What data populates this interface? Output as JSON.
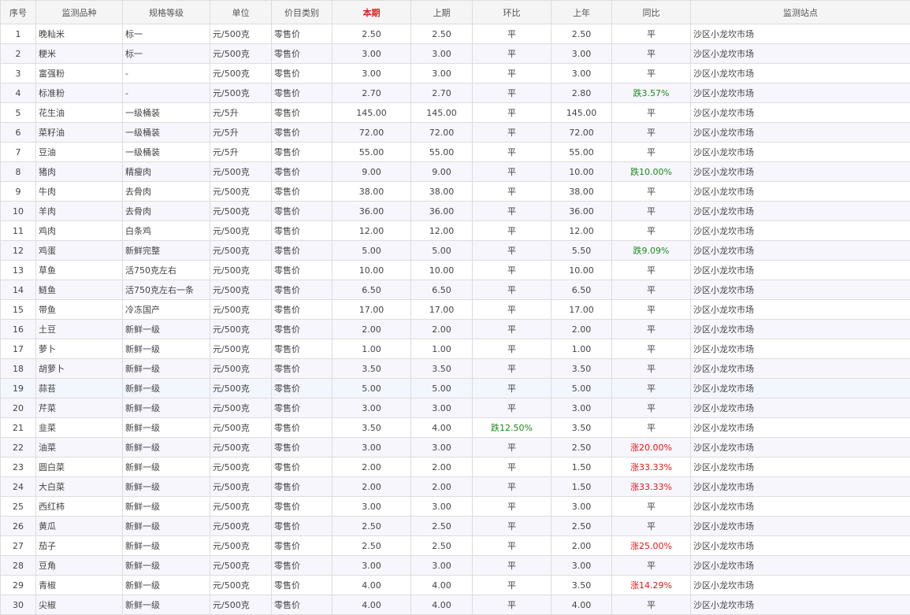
{
  "table": {
    "headers": [
      "序号",
      "监测品种",
      "规格等级",
      "单位",
      "价目类别",
      "本期",
      "上期",
      "环比",
      "上年",
      "同比",
      "监测站点"
    ],
    "rows": [
      {
        "no": "1",
        "item": "晚籼米",
        "grade": "标一",
        "unit": "元/500克",
        "category": "零售价",
        "current": "2.50",
        "previous": "2.50",
        "mom": "平",
        "last_year": "2.50",
        "yoy": "平",
        "site": "沙区小龙坎市场"
      },
      {
        "no": "2",
        "item": "粳米",
        "grade": "标一",
        "unit": "元/500克",
        "category": "零售价",
        "current": "3.00",
        "previous": "3.00",
        "mom": "平",
        "last_year": "3.00",
        "yoy": "平",
        "site": "沙区小龙坎市场"
      },
      {
        "no": "3",
        "item": "富强粉",
        "grade": "-",
        "unit": "元/500克",
        "category": "零售价",
        "current": "3.00",
        "previous": "3.00",
        "mom": "平",
        "last_year": "3.00",
        "yoy": "平",
        "site": "沙区小龙坎市场"
      },
      {
        "no": "4",
        "item": "标准粉",
        "grade": "-",
        "unit": "元/500克",
        "category": "零售价",
        "current": "2.70",
        "previous": "2.70",
        "mom": "平",
        "last_year": "2.80",
        "yoy": "跌3.57%",
        "site": "沙区小龙坎市场"
      },
      {
        "no": "5",
        "item": "花生油",
        "grade": "一级桶装",
        "unit": "元/5升",
        "category": "零售价",
        "current": "145.00",
        "previous": "145.00",
        "mom": "平",
        "last_year": "145.00",
        "yoy": "平",
        "site": "沙区小龙坎市场"
      },
      {
        "no": "6",
        "item": "菜籽油",
        "grade": "一级桶装",
        "unit": "元/5升",
        "category": "零售价",
        "current": "72.00",
        "previous": "72.00",
        "mom": "平",
        "last_year": "72.00",
        "yoy": "平",
        "site": "沙区小龙坎市场"
      },
      {
        "no": "7",
        "item": "豆油",
        "grade": "一级桶装",
        "unit": "元/5升",
        "category": "零售价",
        "current": "55.00",
        "previous": "55.00",
        "mom": "平",
        "last_year": "55.00",
        "yoy": "平",
        "site": "沙区小龙坎市场"
      },
      {
        "no": "8",
        "item": "猪肉",
        "grade": "精瘦肉",
        "unit": "元/500克",
        "category": "零售价",
        "current": "9.00",
        "previous": "9.00",
        "mom": "平",
        "last_year": "10.00",
        "yoy": "跌10.00%",
        "site": "沙区小龙坎市场"
      },
      {
        "no": "9",
        "item": "牛肉",
        "grade": "去骨肉",
        "unit": "元/500克",
        "category": "零售价",
        "current": "38.00",
        "previous": "38.00",
        "mom": "平",
        "last_year": "38.00",
        "yoy": "平",
        "site": "沙区小龙坎市场"
      },
      {
        "no": "10",
        "item": "羊肉",
        "grade": "去骨肉",
        "unit": "元/500克",
        "category": "零售价",
        "current": "36.00",
        "previous": "36.00",
        "mom": "平",
        "last_year": "36.00",
        "yoy": "平",
        "site": "沙区小龙坎市场"
      },
      {
        "no": "11",
        "item": "鸡肉",
        "grade": "白条鸡",
        "unit": "元/500克",
        "category": "零售价",
        "current": "12.00",
        "previous": "12.00",
        "mom": "平",
        "last_year": "12.00",
        "yoy": "平",
        "site": "沙区小龙坎市场"
      },
      {
        "no": "12",
        "item": "鸡蛋",
        "grade": "新鲜完整",
        "unit": "元/500克",
        "category": "零售价",
        "current": "5.00",
        "previous": "5.00",
        "mom": "平",
        "last_year": "5.50",
        "yoy": "跌9.09%",
        "site": "沙区小龙坎市场"
      },
      {
        "no": "13",
        "item": "草鱼",
        "grade": "活750克左右",
        "unit": "元/500克",
        "category": "零售价",
        "current": "10.00",
        "previous": "10.00",
        "mom": "平",
        "last_year": "10.00",
        "yoy": "平",
        "site": "沙区小龙坎市场"
      },
      {
        "no": "14",
        "item": "鲢鱼",
        "grade": "活750克左右一条",
        "unit": "元/500克",
        "category": "零售价",
        "current": "6.50",
        "previous": "6.50",
        "mom": "平",
        "last_year": "6.50",
        "yoy": "平",
        "site": "沙区小龙坎市场"
      },
      {
        "no": "15",
        "item": "带鱼",
        "grade": "冷冻国产",
        "unit": "元/500克",
        "category": "零售价",
        "current": "17.00",
        "previous": "17.00",
        "mom": "平",
        "last_year": "17.00",
        "yoy": "平",
        "site": "沙区小龙坎市场"
      },
      {
        "no": "16",
        "item": "土豆",
        "grade": "新鲜一级",
        "unit": "元/500克",
        "category": "零售价",
        "current": "2.00",
        "previous": "2.00",
        "mom": "平",
        "last_year": "2.00",
        "yoy": "平",
        "site": "沙区小龙坎市场"
      },
      {
        "no": "17",
        "item": "萝卜",
        "grade": "新鲜一级",
        "unit": "元/500克",
        "category": "零售价",
        "current": "1.00",
        "previous": "1.00",
        "mom": "平",
        "last_year": "1.00",
        "yoy": "平",
        "site": "沙区小龙坎市场"
      },
      {
        "no": "18",
        "item": "胡萝卜",
        "grade": "新鲜一级",
        "unit": "元/500克",
        "category": "零售价",
        "current": "3.50",
        "previous": "3.50",
        "mom": "平",
        "last_year": "3.50",
        "yoy": "平",
        "site": "沙区小龙坎市场"
      },
      {
        "no": "19",
        "item": "蒜苔",
        "grade": "新鲜一级",
        "unit": "元/500克",
        "category": "零售价",
        "current": "5.00",
        "previous": "5.00",
        "mom": "平",
        "last_year": "5.00",
        "yoy": "平",
        "site": "沙区小龙坎市场"
      },
      {
        "no": "20",
        "item": "芹菜",
        "grade": "新鲜一级",
        "unit": "元/500克",
        "category": "零售价",
        "current": "3.00",
        "previous": "3.00",
        "mom": "平",
        "last_year": "3.00",
        "yoy": "平",
        "site": "沙区小龙坎市场"
      },
      {
        "no": "21",
        "item": "韭菜",
        "grade": "新鲜一级",
        "unit": "元/500克",
        "category": "零售价",
        "current": "3.50",
        "previous": "4.00",
        "mom": "跌12.50%",
        "last_year": "3.50",
        "yoy": "平",
        "site": "沙区小龙坎市场"
      },
      {
        "no": "22",
        "item": "油菜",
        "grade": "新鲜一级",
        "unit": "元/500克",
        "category": "零售价",
        "current": "3.00",
        "previous": "3.00",
        "mom": "平",
        "last_year": "2.50",
        "yoy": "涨20.00%",
        "site": "沙区小龙坎市场"
      },
      {
        "no": "23",
        "item": "圆白菜",
        "grade": "新鲜一级",
        "unit": "元/500克",
        "category": "零售价",
        "current": "2.00",
        "previous": "2.00",
        "mom": "平",
        "last_year": "1.50",
        "yoy": "涨33.33%",
        "site": "沙区小龙坎市场"
      },
      {
        "no": "24",
        "item": "大白菜",
        "grade": "新鲜一级",
        "unit": "元/500克",
        "category": "零售价",
        "current": "2.00",
        "previous": "2.00",
        "mom": "平",
        "last_year": "1.50",
        "yoy": "涨33.33%",
        "site": "沙区小龙坎市场"
      },
      {
        "no": "25",
        "item": "西红柿",
        "grade": "新鲜一级",
        "unit": "元/500克",
        "category": "零售价",
        "current": "3.00",
        "previous": "3.00",
        "mom": "平",
        "last_year": "3.00",
        "yoy": "平",
        "site": "沙区小龙坎市场"
      },
      {
        "no": "26",
        "item": "黄瓜",
        "grade": "新鲜一级",
        "unit": "元/500克",
        "category": "零售价",
        "current": "2.50",
        "previous": "2.50",
        "mom": "平",
        "last_year": "2.50",
        "yoy": "平",
        "site": "沙区小龙坎市场"
      },
      {
        "no": "27",
        "item": "茄子",
        "grade": "新鲜一级",
        "unit": "元/500克",
        "category": "零售价",
        "current": "2.50",
        "previous": "2.50",
        "mom": "平",
        "last_year": "2.00",
        "yoy": "涨25.00%",
        "site": "沙区小龙坎市场"
      },
      {
        "no": "28",
        "item": "豆角",
        "grade": "新鲜一级",
        "unit": "元/500克",
        "category": "零售价",
        "current": "3.00",
        "previous": "3.00",
        "mom": "平",
        "last_year": "3.00",
        "yoy": "平",
        "site": "沙区小龙坎市场"
      },
      {
        "no": "29",
        "item": "青椒",
        "grade": "新鲜一级",
        "unit": "元/500克",
        "category": "零售价",
        "current": "4.00",
        "previous": "4.00",
        "mom": "平",
        "last_year": "3.50",
        "yoy": "涨14.29%",
        "site": "沙区小龙坎市场"
      },
      {
        "no": "30",
        "item": "尖椒",
        "grade": "新鲜一级",
        "unit": "元/500克",
        "category": "零售价",
        "current": "4.00",
        "previous": "4.00",
        "mom": "平",
        "last_year": "4.00",
        "yoy": "平",
        "site": "沙区小龙坎市场"
      }
    ]
  },
  "colors": {
    "highlight_header": "#e02020",
    "down": "#1a8a1a",
    "up": "#e01818",
    "stripe": "#f7f6fd"
  }
}
